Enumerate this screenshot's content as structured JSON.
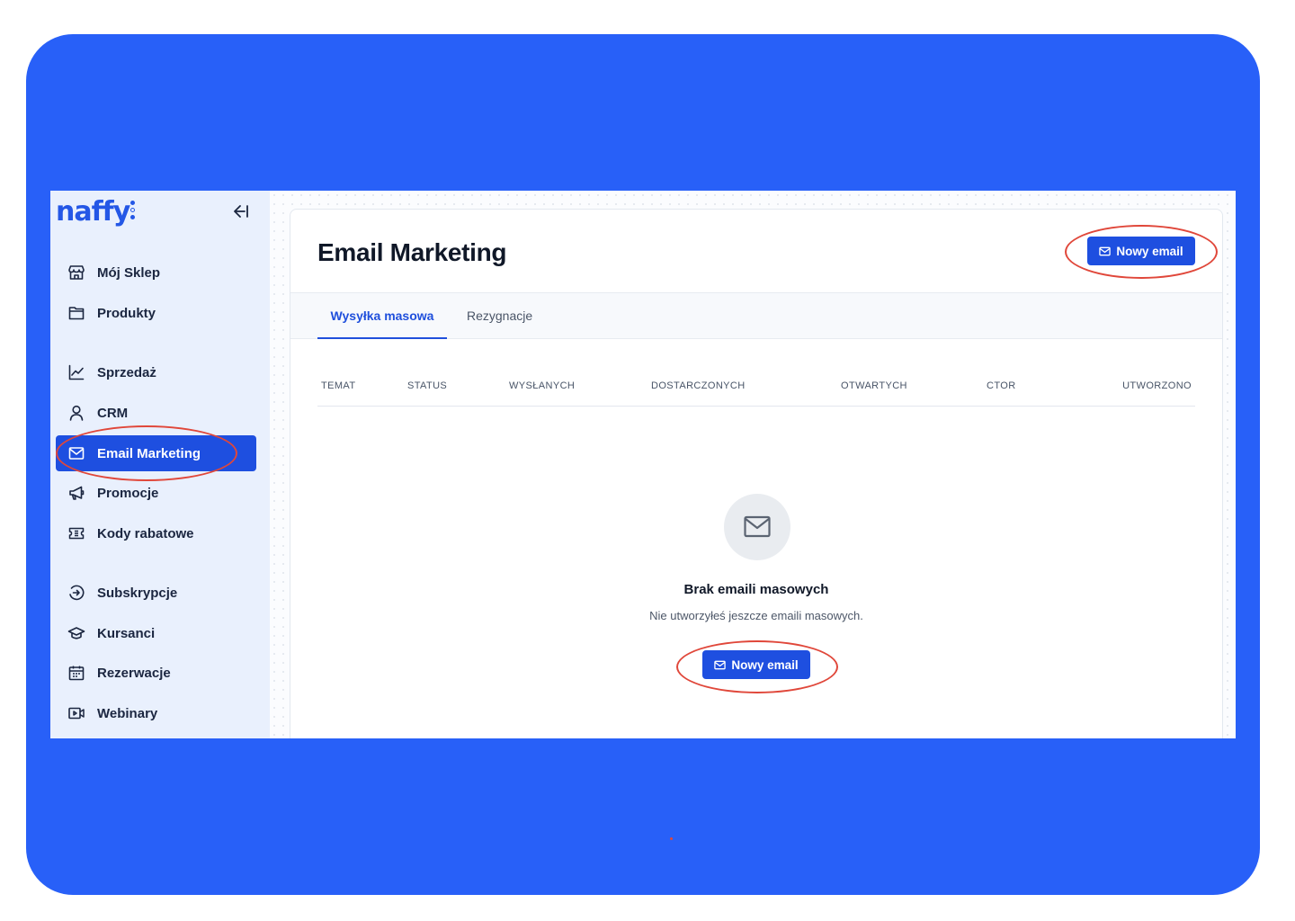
{
  "app": {
    "logo": "naffy"
  },
  "sidebar": {
    "items": [
      {
        "label": "Mój Sklep",
        "icon": "store-icon"
      },
      {
        "label": "Produkty",
        "icon": "folder-icon"
      },
      {
        "label": "Sprzedaż",
        "icon": "chart-line-icon"
      },
      {
        "label": "CRM",
        "icon": "user-icon"
      },
      {
        "label": "Email Marketing",
        "icon": "mail-icon",
        "active": true
      },
      {
        "label": "Promocje",
        "icon": "megaphone-icon"
      },
      {
        "label": "Kody rabatowe",
        "icon": "ticket-icon"
      },
      {
        "label": "Subskrypcje",
        "icon": "subscription-icon"
      },
      {
        "label": "Kursanci",
        "icon": "graduation-cap-icon"
      },
      {
        "label": "Rezerwacje",
        "icon": "calendar-icon"
      },
      {
        "label": "Webinary",
        "icon": "video-icon"
      }
    ]
  },
  "page": {
    "title": "Email Marketing",
    "new_email_label": "Nowy email",
    "tabs": [
      {
        "label": "Wysyłka masowa",
        "active": true
      },
      {
        "label": "Rezygnacje",
        "active": false
      }
    ],
    "table": {
      "columns": [
        "TEMAT",
        "STATUS",
        "WYSŁANYCH",
        "DOSTARCZONYCH",
        "OTWARTYCH",
        "CTOR",
        "UTWORZONO"
      ]
    },
    "empty": {
      "title": "Brak emaili masowych",
      "subtitle": "Nie utworzyłeś jeszcze emaili masowych.",
      "button_label": "Nowy email"
    }
  },
  "colors": {
    "frame": "#2860f8",
    "accent": "#1e4fe0",
    "sidebar_bg": "#e9f0fd",
    "annotation": "#e0473a"
  }
}
